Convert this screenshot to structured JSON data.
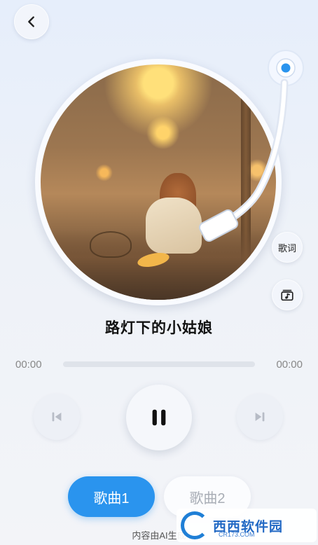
{
  "header": {
    "back_icon": "chevron-left-icon"
  },
  "player": {
    "song_title": "路灯下的小姑娘",
    "time_current": "00:00",
    "time_total": "00:00",
    "progress": 0,
    "lyrics_label": "歌词",
    "playlist_icon": "music-playlist-icon",
    "controls": {
      "prev_icon": "skip-previous-icon",
      "play_pause_icon": "pause-icon",
      "next_icon": "skip-next-icon"
    }
  },
  "song_tabs": [
    {
      "label": "歌曲1",
      "selected": true
    },
    {
      "label": "歌曲2",
      "selected": false
    }
  ],
  "footer": {
    "ai_note": "内容由AI生成"
  },
  "watermark": {
    "title": "西西软件园",
    "subtitle": "CR173.COM"
  },
  "colors": {
    "accent": "#2a94ee",
    "background": "#eef2f8"
  }
}
